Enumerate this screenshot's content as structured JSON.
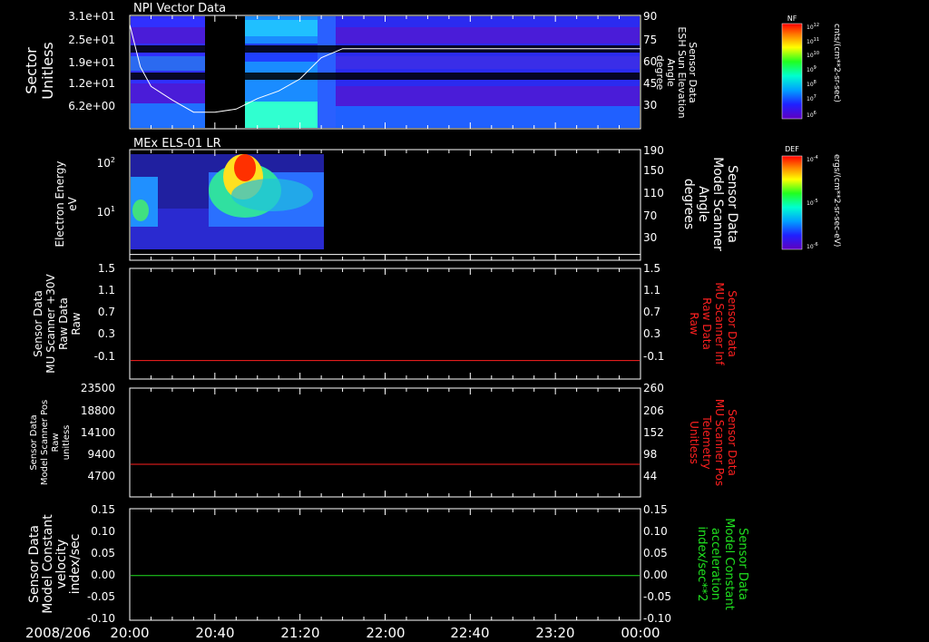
{
  "date_label": "2008/206",
  "time_ticks": [
    "20:00",
    "20:40",
    "21:20",
    "22:00",
    "22:40",
    "23:20",
    "00:00"
  ],
  "panels": [
    {
      "title": "NPI Vector Data",
      "left_label": [
        "Sector",
        "Unitless"
      ],
      "left_ticks": [
        "3.1e+01",
        "2.5e+01",
        "1.9e+01",
        "1.2e+01",
        "6.2e+00"
      ],
      "right_label": [
        "Sensor Data",
        "ESH Sun Elevation",
        "Angle",
        "degree"
      ],
      "right_ticks": [
        "90",
        "75",
        "60",
        "45",
        "30"
      ],
      "right_color": "#ffffff"
    },
    {
      "title": "MEx ELS-01 LR",
      "left_label": [
        "Electron Energy",
        "eV"
      ],
      "left_ticks": [
        "10^2",
        "10^1"
      ],
      "right_label": [
        "Sensor Data",
        "Model Scanner",
        "Angle",
        "degrees"
      ],
      "right_ticks": [
        "190",
        "150",
        "110",
        "70",
        "30"
      ],
      "right_color": "#ffffff"
    },
    {
      "title": "",
      "left_label": [
        "Sensor Data",
        "MU Scanner +30V",
        "Raw Data",
        "Raw"
      ],
      "left_ticks": [
        "1.5",
        "1.1",
        "0.7",
        "0.3",
        "-0.1"
      ],
      "right_label": [
        "Sensor Data",
        "MU Scanner Inf",
        "Raw Data",
        "Raw"
      ],
      "right_ticks": [
        "1.5",
        "1.1",
        "0.7",
        "0.3",
        "-0.1"
      ],
      "right_color": "#ff2020"
    },
    {
      "title": "",
      "left_label": [
        "Sensor Data",
        "Model Scanner Pos",
        "Raw",
        "unitless"
      ],
      "left_ticks": [
        "23500",
        "18800",
        "14100",
        "9400",
        "4700"
      ],
      "right_label": [
        "Sensor Data",
        "MU Scanner Pos",
        "Telemetry",
        "Unitless"
      ],
      "right_ticks": [
        "260",
        "206",
        "152",
        "98",
        "44"
      ],
      "right_color": "#ff2020"
    },
    {
      "title": "",
      "left_label": [
        "Sensor Data",
        "Model Constant",
        "velocity",
        "index/sec"
      ],
      "left_ticks": [
        "0.15",
        "0.10",
        "0.05",
        "0.00",
        "-0.05",
        "-0.10"
      ],
      "right_label": [
        "Sensor Data",
        "Model Constant",
        "acceleration",
        "index/sec**2"
      ],
      "right_ticks": [
        "0.15",
        "0.10",
        "0.05",
        "0.00",
        "-0.05",
        "-0.10"
      ],
      "right_color": "#20e020"
    }
  ],
  "colorbars": [
    {
      "label": "NF",
      "units": "cnts/(cm**2-sr-sec)",
      "ticks": [
        "10^12",
        "10^11",
        "10^10",
        "10^9",
        "10^8",
        "10^7",
        "10^6"
      ]
    },
    {
      "label": "DEF",
      "units": "ergs/(cm**2-sr-sec-eV)",
      "ticks": [
        "10^-4",
        "10^-5",
        "10^-6"
      ]
    }
  ],
  "chart_data": [
    {
      "type": "heatmap",
      "title": "NPI Vector Data",
      "xlabel": "",
      "ylabel": "Sector Unitless",
      "x_range": [
        "20:00",
        "00:00"
      ],
      "y_range": [
        0,
        31
      ],
      "data_gaps": [
        [
          "20:30",
          "20:40"
        ]
      ],
      "overlay_line": {
        "name": "ESH Sun Elevation Angle",
        "axis": "right",
        "y2_range": [
          15,
          90
        ],
        "x": [
          "20:00",
          "20:05",
          "20:10",
          "20:20",
          "20:30",
          "20:40",
          "20:50",
          "21:00",
          "21:10",
          "21:20",
          "21:30",
          "21:40",
          "22:00",
          "23:00",
          "00:00"
        ],
        "values": [
          84,
          56,
          43,
          34,
          26,
          26,
          28,
          35,
          40,
          48,
          62,
          68,
          68,
          68,
          68
        ]
      }
    },
    {
      "type": "heatmap",
      "title": "MEx ELS-01 LR",
      "xlabel": "",
      "ylabel": "Electron Energy eV",
      "y_scale": "log",
      "y_range": [
        1,
        200
      ],
      "data_coverage": [
        "20:00",
        "21:25"
      ],
      "overlay_line": {
        "name": "Model Scanner Angle",
        "axis": "right",
        "y2_range": [
          0,
          190
        ],
        "x": [
          "20:00",
          "00:00"
        ],
        "values": [
          10,
          10
        ]
      }
    },
    {
      "type": "line",
      "ylabel": "MU Scanner +30V Raw Data",
      "ylim": [
        -0.3,
        1.5
      ],
      "y2lim": [
        -0.3,
        1.5
      ],
      "series": [
        {
          "name": "MU Scanner Inf Raw Data",
          "color": "#ff2020",
          "x": [
            "20:00",
            "00:00"
          ],
          "values": [
            0.0,
            0.0
          ]
        }
      ]
    },
    {
      "type": "line",
      "ylabel": "Model Scanner Pos Raw",
      "ylim": [
        0,
        23500
      ],
      "y2lim": [
        0,
        260
      ],
      "series": [
        {
          "name": "MU Scanner Pos Telemetry",
          "color": "#ff2020",
          "axis": "right",
          "x": [
            "20:00",
            "00:00"
          ],
          "values": [
            78,
            78
          ]
        }
      ]
    },
    {
      "type": "line",
      "ylabel": "Model Constant velocity",
      "ylim": [
        -0.1,
        0.15
      ],
      "y2lim": [
        -0.1,
        0.15
      ],
      "series": [
        {
          "name": "Model Constant acceleration",
          "color": "#20e020",
          "x": [
            "20:00",
            "00:00"
          ],
          "values": [
            0.0,
            0.0
          ]
        }
      ]
    }
  ]
}
